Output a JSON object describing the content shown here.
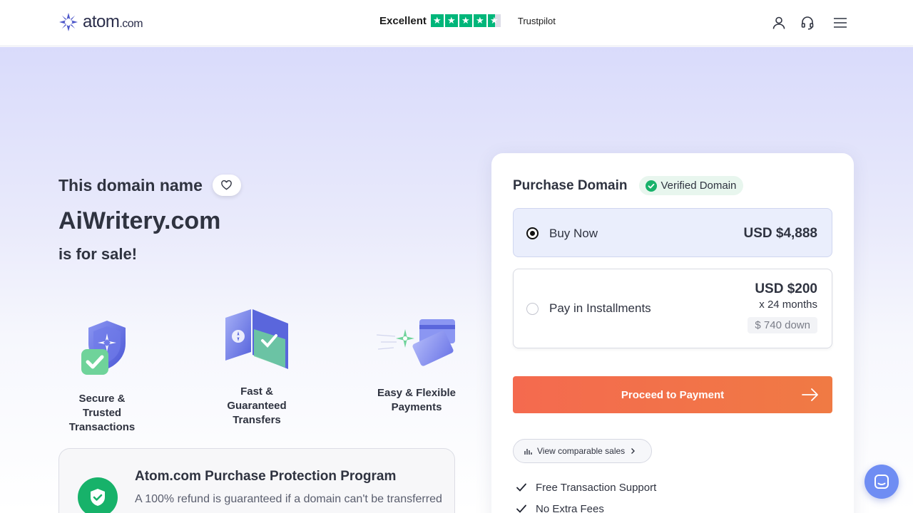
{
  "header": {
    "logo_main": "atom",
    "logo_suffix": ".com",
    "rating_label": "Excellent",
    "rating_stars": 4.5,
    "rating_brand": "Trustpilot",
    "icons": [
      "user-icon",
      "headset-icon",
      "menu-icon"
    ]
  },
  "hero": {
    "line1": "This domain name",
    "domain": "AiWritery.com",
    "line3": "is for sale!"
  },
  "features": [
    {
      "label": "Secure & Trusted Transactions",
      "icon": "shield-check-icon"
    },
    {
      "label": "Fast & Guaranteed Transfers",
      "icon": "transfer-icon"
    },
    {
      "label": "Easy & Flexible Payments",
      "icon": "card-icon"
    }
  ],
  "protection": {
    "title": "Atom.com Purchase Protection Program",
    "text": "A 100% refund is guaranteed if a domain can't be transferred"
  },
  "purchase": {
    "title": "Purchase Domain",
    "badge": "Verified Domain",
    "options": [
      {
        "label": "Buy Now",
        "price": "USD $4,888",
        "selected": true
      },
      {
        "label": "Pay in Installments",
        "price": "USD $200",
        "term": "x 24 months",
        "down": "$ 740 down",
        "selected": false
      }
    ],
    "cta": "Proceed to Payment",
    "comparable": "View comparable sales",
    "perks": [
      "Free Transaction Support",
      "No Extra Fees"
    ]
  },
  "colors": {
    "accent": "#f46a4f",
    "brand": "#5b5fd6",
    "success": "#17b26a",
    "trustpilot": "#00b67a"
  }
}
